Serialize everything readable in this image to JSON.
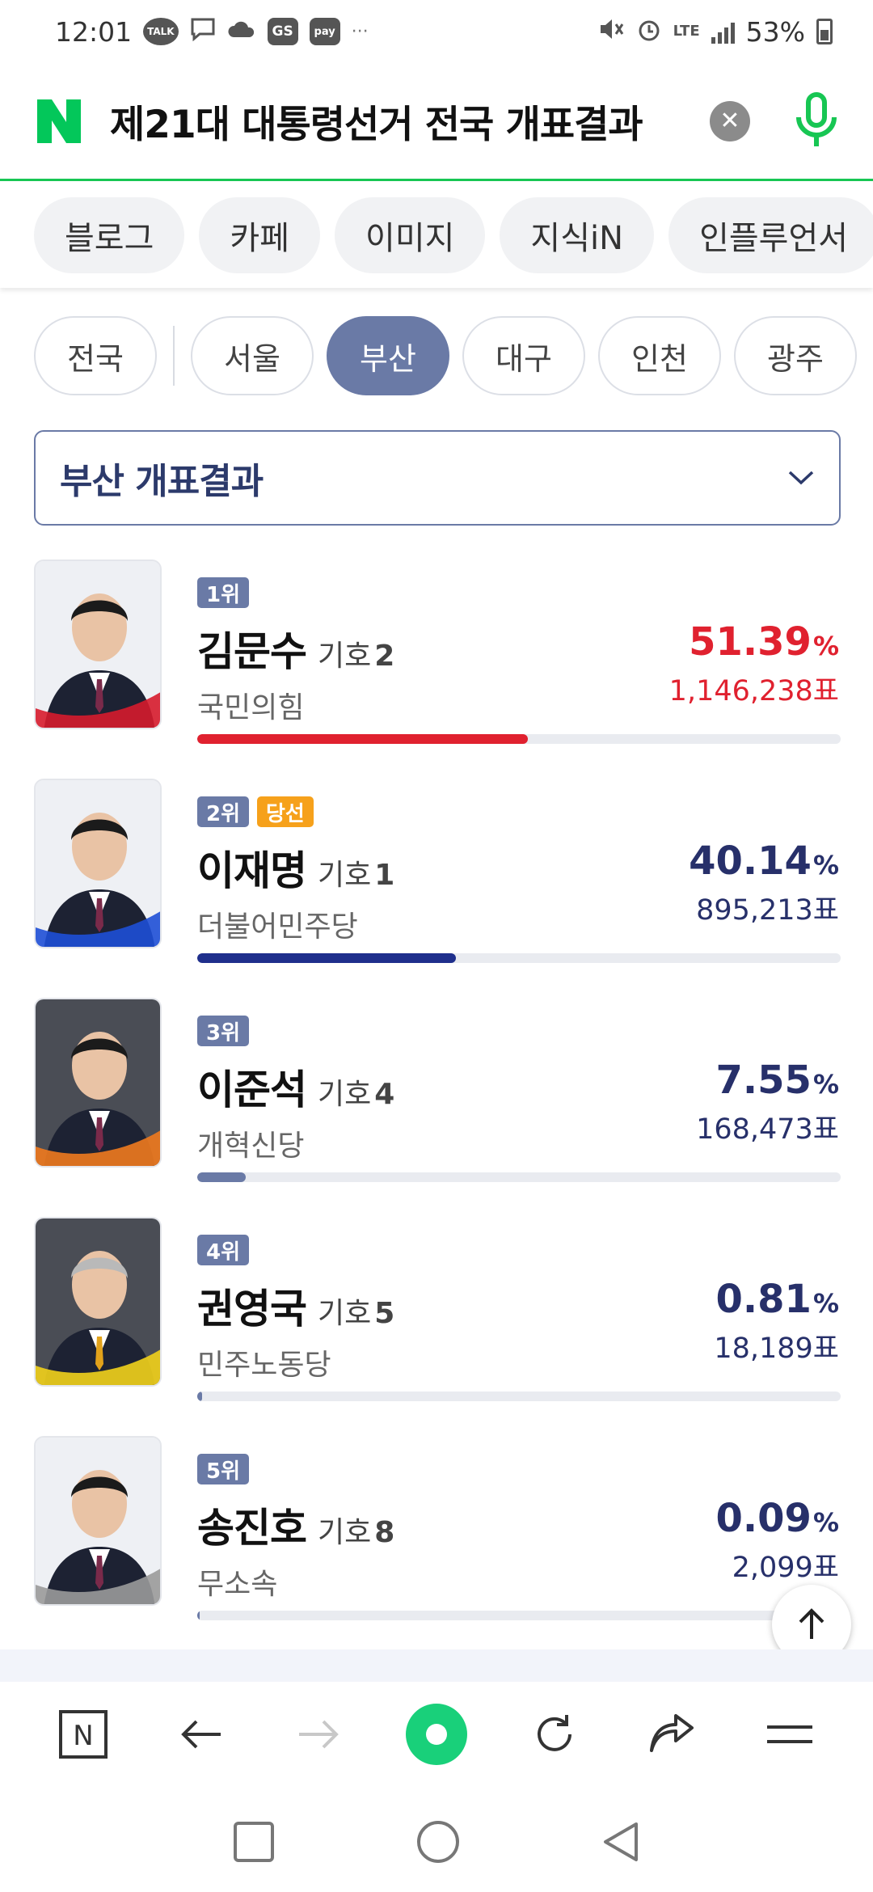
{
  "status_bar": {
    "time": "12:01",
    "notif_talk": "TALK",
    "notif_gs": "GS",
    "notif_pay": "pay",
    "more": "···",
    "network": "LTE",
    "battery": "53%"
  },
  "search": {
    "query": "제21대 대통령선거 전국 개표결과"
  },
  "category_tabs": [
    "블로그",
    "카페",
    "이미지",
    "지식iN",
    "인플루언서"
  ],
  "region_chips": {
    "all": "전국",
    "items": [
      "서울",
      "부산",
      "대구",
      "인천",
      "광주"
    ],
    "selected": "부산"
  },
  "results_dropdown": {
    "label": "부산 개표결과"
  },
  "candidates": [
    {
      "rank": "1위",
      "name": "김문수",
      "number_label": "기호",
      "number": "2",
      "party": "국민의힘",
      "percent": "51.39",
      "percent_unit": "%",
      "votes": "1,146,238표",
      "bar_fraction": 0.5139,
      "color": "#e0212f",
      "photo_accent": "#d61b2c",
      "elected": ""
    },
    {
      "rank": "2위",
      "name": "이재명",
      "number_label": "기호",
      "number": "1",
      "party": "더불어민주당",
      "percent": "40.14",
      "percent_unit": "%",
      "votes": "895,213표",
      "bar_fraction": 0.4014,
      "color": "#1f2f8c",
      "photo_accent": "#1e4fd6",
      "elected": "당선"
    },
    {
      "rank": "3위",
      "name": "이준석",
      "number_label": "기호",
      "number": "4",
      "party": "개혁신당",
      "percent": "7.55",
      "percent_unit": "%",
      "votes": "168,473표",
      "bar_fraction": 0.0755,
      "color": "#6a7aa6",
      "photo_accent": "#f07a1e",
      "elected": ""
    },
    {
      "rank": "4위",
      "name": "권영국",
      "number_label": "기호",
      "number": "5",
      "party": "민주노동당",
      "percent": "0.81",
      "percent_unit": "%",
      "votes": "18,189표",
      "bar_fraction": 0.0081,
      "color": "#6a7aa6",
      "photo_accent": "#f2d21b",
      "elected": ""
    },
    {
      "rank": "5위",
      "name": "송진호",
      "number_label": "기호",
      "number": "8",
      "party": "무소속",
      "percent": "0.09",
      "percent_unit": "%",
      "votes": "2,099표",
      "bar_fraction": 0.0009,
      "color": "#6a7aa6",
      "photo_accent": "#9a9a9a",
      "elected": ""
    }
  ],
  "colors": {
    "naver_green": "#03c75a",
    "chip_active": "#6a7aa6",
    "leader_red": "#e0212f",
    "navy": "#27306a",
    "elected_orange": "#f6a11b"
  },
  "icons": {
    "search_clear": "close-icon",
    "mic": "microphone-icon",
    "dropdown": "chevron-down-icon",
    "scroll_top": "arrow-up-icon",
    "toolbar": [
      "naver-home-icon",
      "back-arrow-icon",
      "forward-arrow-icon",
      "green-dot-icon",
      "refresh-icon",
      "share-icon",
      "menu-icon"
    ],
    "android_nav": [
      "recents-icon",
      "home-icon",
      "back-icon"
    ]
  },
  "toolbar": {
    "home_letter": "N"
  }
}
